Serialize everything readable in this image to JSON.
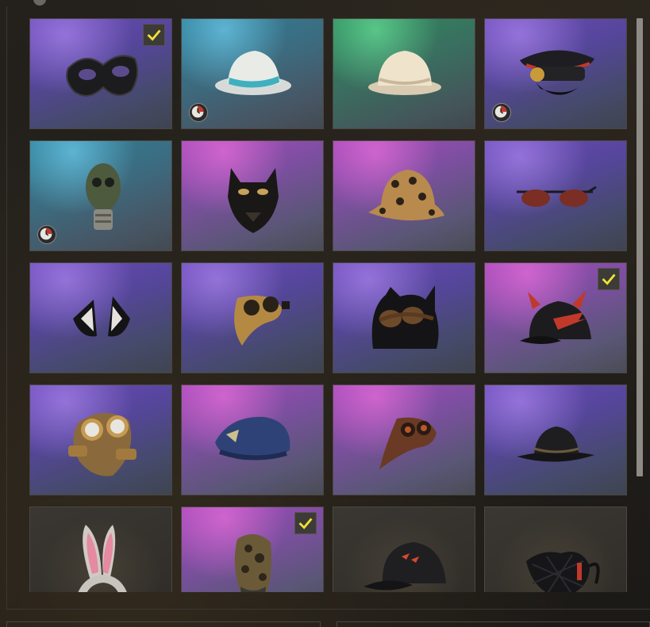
{
  "header": {
    "title": "",
    "right_label": ""
  },
  "items": [
    {
      "name": "black-eye-mask",
      "bg": "purple",
      "selected": true,
      "timed": false
    },
    {
      "name": "white-bucket-hat",
      "bg": "teal",
      "selected": false,
      "timed": true
    },
    {
      "name": "pith-helmet",
      "bg": "green",
      "selected": false,
      "timed": false
    },
    {
      "name": "officer-cap",
      "bg": "purple",
      "selected": false,
      "timed": true
    },
    {
      "name": "gas-mask",
      "bg": "teal",
      "selected": false,
      "timed": true
    },
    {
      "name": "wolf-mask",
      "bg": "pink",
      "selected": false,
      "timed": false
    },
    {
      "name": "leopard-bucket-hat",
      "bg": "pink",
      "selected": false,
      "timed": false
    },
    {
      "name": "sunglasses",
      "bg": "purple",
      "selected": false,
      "timed": false
    },
    {
      "name": "cat-ears",
      "bg": "purple",
      "selected": false,
      "timed": false
    },
    {
      "name": "plague-mask-gold",
      "bg": "purple",
      "selected": false,
      "timed": false
    },
    {
      "name": "cat-beanie-goggles",
      "bg": "purple",
      "selected": false,
      "timed": false
    },
    {
      "name": "devil-cap",
      "bg": "pink",
      "selected": true,
      "timed": false
    },
    {
      "name": "steampunk-gas-mask",
      "bg": "purple",
      "selected": false,
      "timed": false
    },
    {
      "name": "blue-beret",
      "bg": "pink",
      "selected": false,
      "timed": false
    },
    {
      "name": "plague-mask-leather",
      "bg": "pink",
      "selected": false,
      "timed": false
    },
    {
      "name": "black-fedora",
      "bg": "purple",
      "selected": false,
      "timed": false
    },
    {
      "name": "bunny-ears",
      "bg": "dark",
      "selected": false,
      "timed": false
    },
    {
      "name": "camo-balaclava",
      "bg": "pink",
      "selected": true,
      "timed": false
    },
    {
      "name": "black-baseball-cap",
      "bg": "dark",
      "selected": false,
      "timed": false
    },
    {
      "name": "quilted-face-mask",
      "bg": "dark",
      "selected": false,
      "timed": false
    }
  ],
  "colors": {
    "check": "#f2e232",
    "accent_red": "#d32a1e",
    "clock_red": "#c0392b"
  }
}
